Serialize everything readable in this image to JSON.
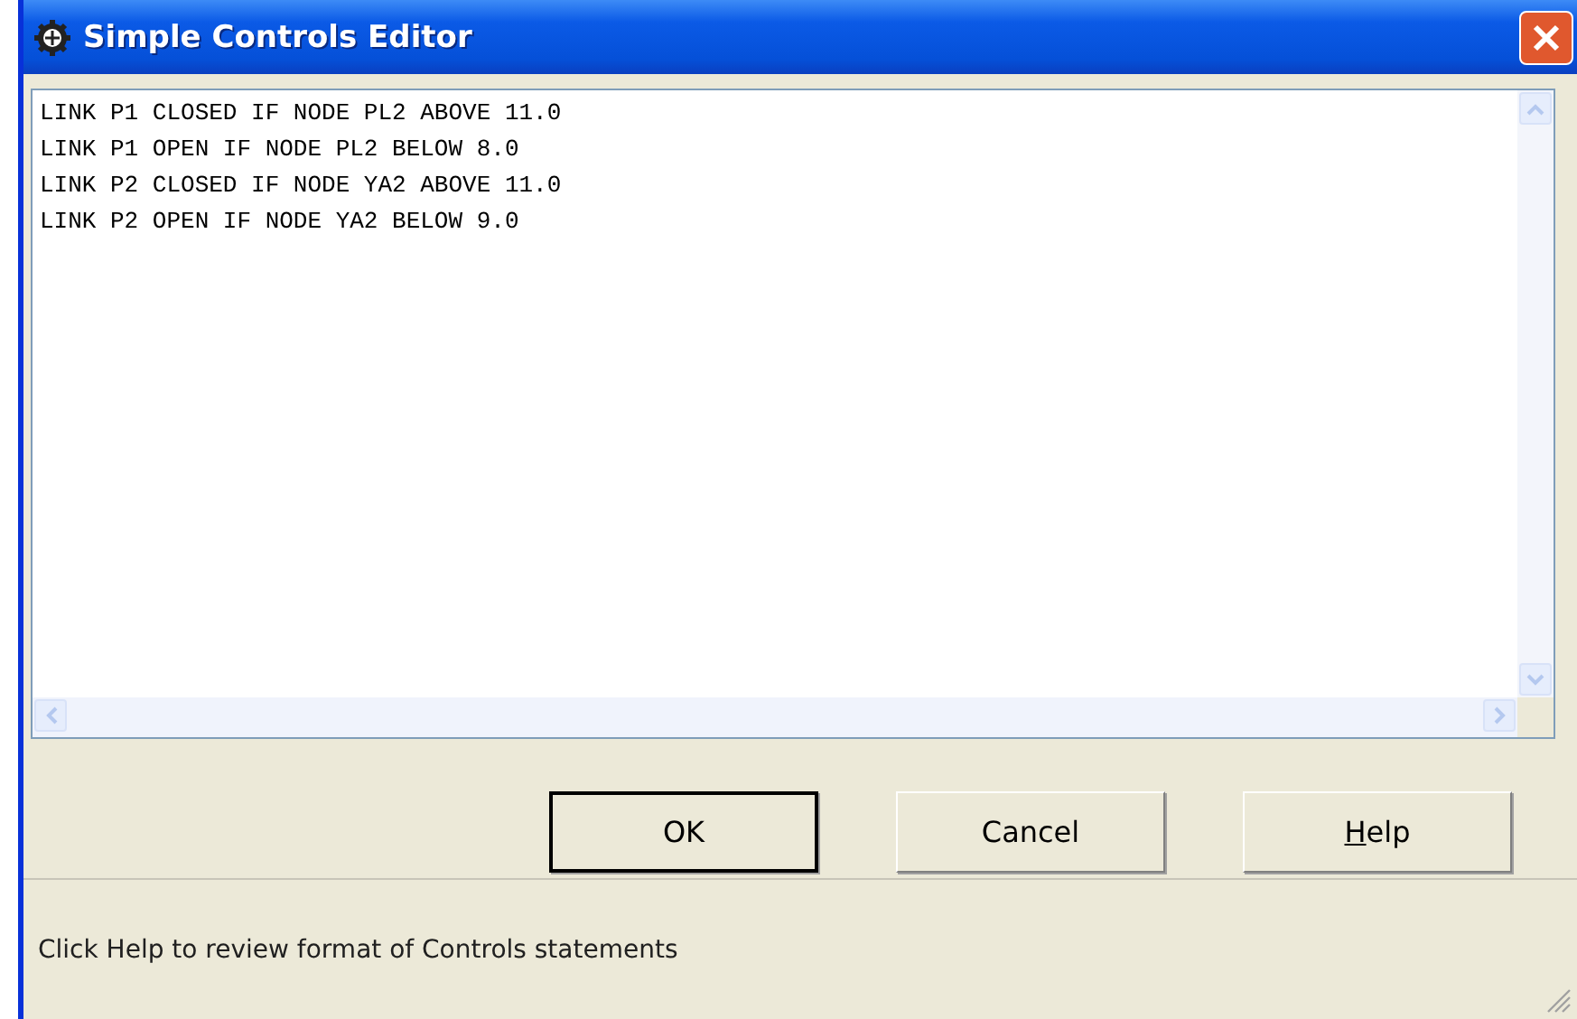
{
  "window": {
    "title": "Simple Controls Editor"
  },
  "editor": {
    "lines": [
      "LINK P1 CLOSED IF NODE PL2 ABOVE 11.0",
      "LINK P1 OPEN IF NODE PL2 BELOW 8.0",
      "LINK P2 CLOSED IF NODE YA2 ABOVE 11.0",
      "LINK P2 OPEN IF NODE YA2 BELOW 9.0"
    ]
  },
  "buttons": [
    {
      "label": "OK",
      "default": true,
      "mnemonic": false
    },
    {
      "label": "Cancel",
      "default": false,
      "mnemonic": false
    },
    {
      "label": "Help",
      "default": false,
      "mnemonic": true
    }
  ],
  "status_bar": {
    "text": "Click Help to review format of Controls statements"
  }
}
